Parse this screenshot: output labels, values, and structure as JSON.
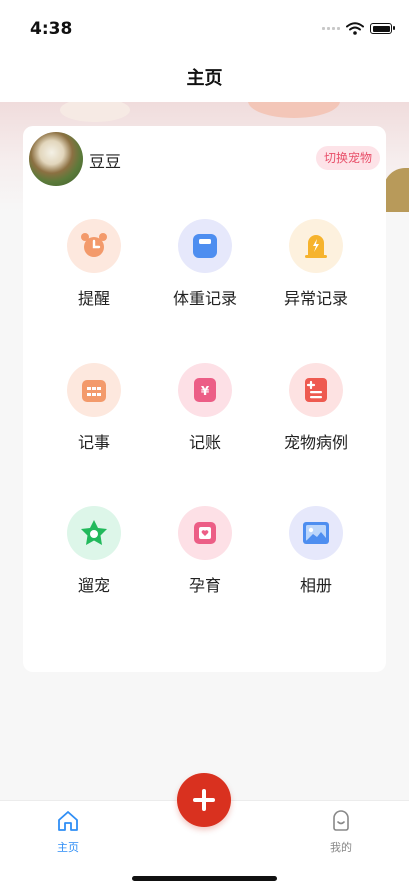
{
  "status": {
    "time": "4:38"
  },
  "header": {
    "title": "主页"
  },
  "pet": {
    "name": "豆豆",
    "switch_label": "切换宠物"
  },
  "features": [
    {
      "label": "提醒",
      "icon": "alarm-clock-icon",
      "bg": "#fde8de",
      "color": "#f39a6b"
    },
    {
      "label": "体重记录",
      "icon": "scale-icon",
      "bg": "#e6e8fb",
      "color": "#4e8ef0"
    },
    {
      "label": "异常记录",
      "icon": "warning-lightning-icon",
      "bg": "#fdf1de",
      "color": "#f6b32d"
    },
    {
      "label": "记事",
      "icon": "calendar-icon",
      "bg": "#fde8de",
      "color": "#f39a6b"
    },
    {
      "label": "记账",
      "icon": "money-icon",
      "bg": "#fde0e6",
      "color": "#ec5e86"
    },
    {
      "label": "宠物病例",
      "icon": "medical-record-icon",
      "bg": "#fde2e2",
      "color": "#ee5a50"
    },
    {
      "label": "遛宠",
      "icon": "star-icon",
      "bg": "#ddf6e9",
      "color": "#22b95c"
    },
    {
      "label": "孕育",
      "icon": "heart-card-icon",
      "bg": "#fde0e6",
      "color": "#ec5e86"
    },
    {
      "label": "相册",
      "icon": "photo-icon",
      "bg": "#e6e8fb",
      "color": "#4e8ef0"
    }
  ],
  "tabbar": {
    "home_label": "主页",
    "mine_label": "我的",
    "active_color": "#2f8ef5",
    "inactive_color": "#888888"
  },
  "fab": {
    "icon": "plus-icon",
    "color": "#d9311f"
  }
}
